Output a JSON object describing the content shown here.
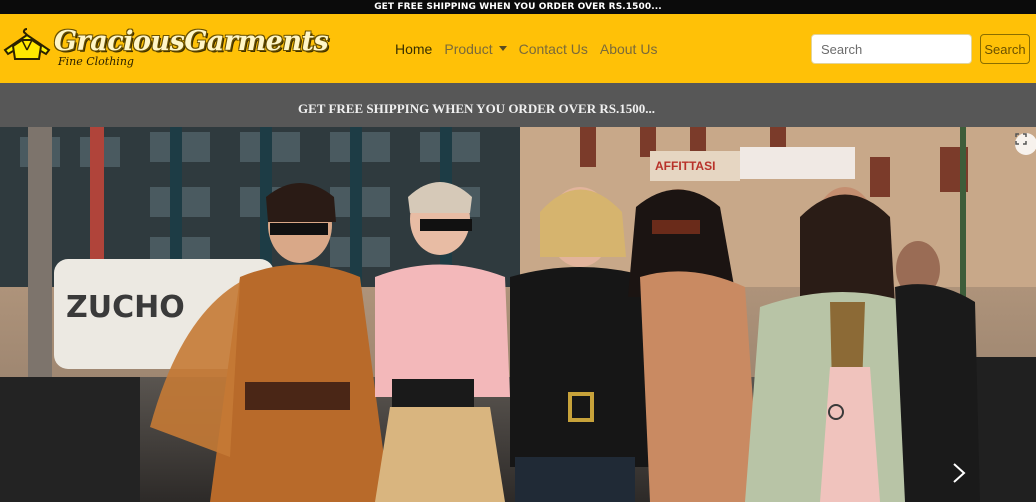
{
  "announcement": {
    "text": "GET FREE SHIPPING WHEN YOU ORDER OVER RS.1500..."
  },
  "brand": {
    "name": "GraciousGarments",
    "tagline": "Fine Clothing",
    "logo_icon": "hanger-shirt-icon"
  },
  "nav": {
    "items": [
      {
        "label": "Home",
        "active": true
      },
      {
        "label": "Product",
        "dropdown": true
      },
      {
        "label": "Contact Us"
      },
      {
        "label": "About Us"
      }
    ]
  },
  "search": {
    "placeholder": "Search",
    "value": "",
    "button_label": "Search"
  },
  "promo": {
    "text": "GET FREE SHIPPING WHEN YOU ORDER OVER RS.1500..."
  },
  "hero": {
    "image_description_icon": "fashion-street-photo",
    "background_text": {
      "van_graffiti": "ZUCHO",
      "shop_sign": "AFFITTASI"
    },
    "next_icon": "chevron-right-icon",
    "fullscreen_icon": "fullscreen-icon"
  },
  "colors": {
    "navbar": "#ffc107",
    "topbar": "#0b0b0b",
    "promo_band": "#575757",
    "accent_text": "#7a6a3a"
  }
}
